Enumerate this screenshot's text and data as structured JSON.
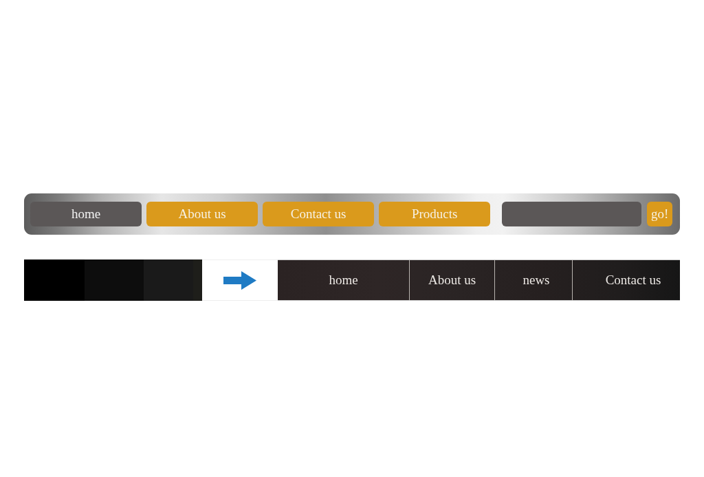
{
  "top_nav": {
    "items": [
      {
        "label": "home",
        "selected": true
      },
      {
        "label": "About us",
        "selected": false
      },
      {
        "label": "Contact us",
        "selected": false
      },
      {
        "label": "Products",
        "selected": false
      }
    ],
    "search": {
      "button": "go!"
    }
  },
  "bottom_nav": {
    "items": [
      {
        "label": "home"
      },
      {
        "label": "About us"
      },
      {
        "label": "news"
      },
      {
        "label": "Contact us"
      }
    ]
  }
}
